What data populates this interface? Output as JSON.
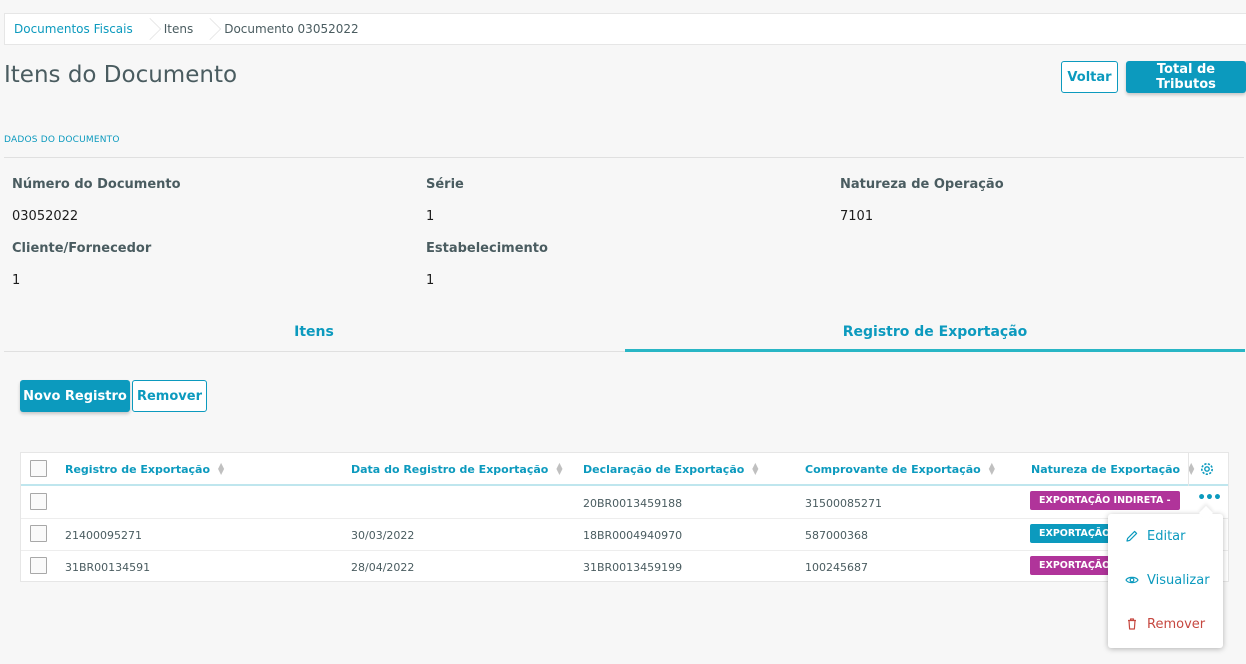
{
  "breadcrumb": {
    "items": [
      "Documentos Fiscais",
      "Itens",
      "Documento 03052022"
    ]
  },
  "page": {
    "title": "Itens do Documento",
    "back_label": "Voltar",
    "tributos_label": "Total de Tributos"
  },
  "section": {
    "title": "DADOS DO DOCUMENTO"
  },
  "fields": {
    "numero": {
      "label": "Número do Documento",
      "value": "03052022"
    },
    "serie": {
      "label": "Série",
      "value": "1"
    },
    "natureza": {
      "label": "Natureza de Operação",
      "value": "7101"
    },
    "cliente": {
      "label": "Cliente/Fornecedor",
      "value": "1"
    },
    "estabelecimento": {
      "label": "Estabelecimento",
      "value": "1"
    }
  },
  "tabs": [
    {
      "label": "Itens",
      "active": false
    },
    {
      "label": "Registro de Exportação",
      "active": true
    }
  ],
  "actions": {
    "novo_label": "Novo Registro",
    "remover_label": "Remover"
  },
  "table": {
    "columns": [
      "Registro de Exportação",
      "Data do Registro de Exportação",
      "Declaração de Exportação",
      "Comprovante de Exportação",
      "Natureza de Exportação"
    ],
    "rows": [
      {
        "registro": "",
        "data": "",
        "declaracao": "20BR0013459188",
        "comprovante": "31500085271",
        "natureza": "EXPORTAÇÃO INDIRETA -",
        "badge_color": "#b0349a"
      },
      {
        "registro": "21400095271",
        "data": "30/03/2022",
        "declaracao": "18BR0004940970",
        "comprovante": "587000368",
        "natureza": "EXPORTAÇÃO",
        "badge_color": "#0c9abe"
      },
      {
        "registro": "31BR00134591",
        "data": "28/04/2022",
        "declaracao": "31BR0013459199",
        "comprovante": "100245687",
        "natureza": "EXPORTAÇÃO",
        "badge_color": "#b0349a"
      }
    ]
  },
  "menu": {
    "items": [
      {
        "label": "Editar",
        "icon": "pencil-icon"
      },
      {
        "label": "Visualizar",
        "icon": "eye-icon"
      },
      {
        "label": "Remover",
        "icon": "trash-icon"
      }
    ]
  },
  "colors": {
    "primary": "#0c9abe",
    "tab_active": "#29b6c5",
    "danger": "#c64840",
    "badge_purple": "#b0349a"
  }
}
